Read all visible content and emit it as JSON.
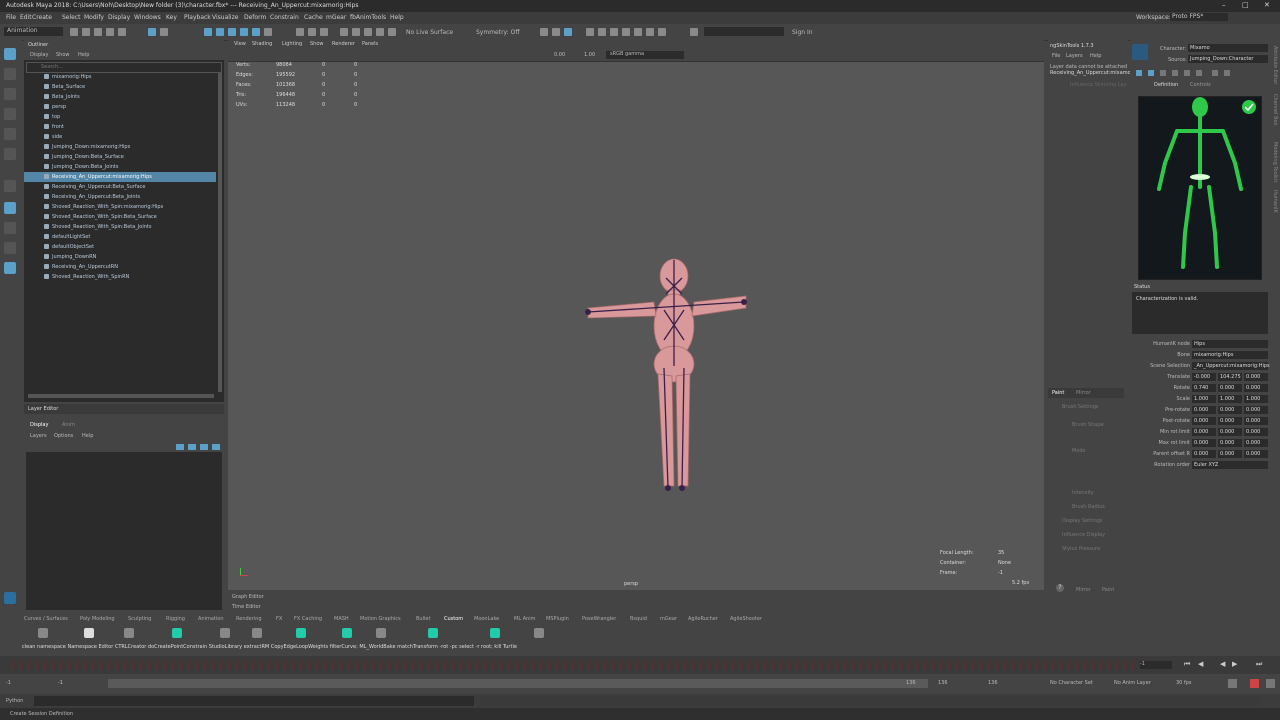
{
  "window": {
    "title": "Autodesk Maya 2018: C:\\Users\\Noh\\Desktop\\New folder (3)\\character.fbx* --- Receiving_An_Uppercut:mixamorig:Hips"
  },
  "menubar": {
    "items": [
      "File",
      "Edit",
      "Create",
      "Select",
      "Modify",
      "Display",
      "Windows",
      "Key",
      "Playback",
      "Visualize",
      "Deform",
      "Constrain",
      "Cache",
      "mGear",
      "fbAnimTools",
      "Help"
    ],
    "workspace_label": "Workspace:",
    "workspace_value": "Proto FPS*"
  },
  "statusline": {
    "mode": "Animation",
    "live_surface": "No Live Surface",
    "symmetry": "Symmetry: Off",
    "sign_in": "Sign In"
  },
  "outliner": {
    "title": "Outliner",
    "menu": [
      "Display",
      "Show",
      "Help"
    ],
    "search_placeholder": "Search...",
    "rows": [
      {
        "label": "mixamorig:Hips",
        "indent": 1,
        "selected": false
      },
      {
        "label": "Beta_Surface",
        "indent": 1,
        "selected": false
      },
      {
        "label": "Beta_Joints",
        "indent": 1,
        "selected": false
      },
      {
        "label": "persp",
        "indent": 1,
        "selected": false
      },
      {
        "label": "top",
        "indent": 1,
        "selected": false
      },
      {
        "label": "front",
        "indent": 1,
        "selected": false
      },
      {
        "label": "side",
        "indent": 1,
        "selected": false
      },
      {
        "label": "Jumping_Down:mixamorig:Hips",
        "indent": 0,
        "selected": false
      },
      {
        "label": "Jumping_Down:Beta_Surface",
        "indent": 0,
        "selected": false
      },
      {
        "label": "Jumping_Down:Beta_Joints",
        "indent": 0,
        "selected": false
      },
      {
        "label": "Receiving_An_Uppercut:mixamorig:Hips",
        "indent": 0,
        "selected": true
      },
      {
        "label": "Receiving_An_Uppercut:Beta_Surface",
        "indent": 0,
        "selected": false
      },
      {
        "label": "Receiving_An_Uppercut:Beta_Joints",
        "indent": 0,
        "selected": false
      },
      {
        "label": "Shoved_Reaction_With_Spin:mixamorig:Hips",
        "indent": 0,
        "selected": false
      },
      {
        "label": "Shoved_Reaction_With_Spin:Beta_Surface",
        "indent": 0,
        "selected": false
      },
      {
        "label": "Shoved_Reaction_With_Spin:Beta_Joints",
        "indent": 0,
        "selected": false
      },
      {
        "label": "defaultLightSet",
        "indent": 0,
        "selected": false
      },
      {
        "label": "defaultObjectSet",
        "indent": 0,
        "selected": false
      },
      {
        "label": "Jumping_DownRN",
        "indent": 0,
        "selected": false
      },
      {
        "label": "Receiving_An_UppercutRN",
        "indent": 0,
        "selected": false
      },
      {
        "label": "Shoved_Reaction_With_SpinRN",
        "indent": 0,
        "selected": false
      }
    ]
  },
  "layer_editor": {
    "title": "Layer Editor",
    "tabs": [
      "Display",
      "Anim"
    ],
    "menu": [
      "Layers",
      "Options",
      "Help"
    ]
  },
  "viewport": {
    "menu": [
      "View",
      "Shading",
      "Lighting",
      "Show",
      "Renderer",
      "Panels"
    ],
    "gamma": "sRGB gamma",
    "val1": "0.00",
    "val2": "1.00",
    "stats": [
      {
        "label": "Verts:",
        "a": "98084",
        "b": "0",
        "c": "0"
      },
      {
        "label": "Edges:",
        "a": "195592",
        "b": "0",
        "c": "0"
      },
      {
        "label": "Faces:",
        "a": "101368",
        "b": "0",
        "c": "0"
      },
      {
        "label": "Tris:",
        "a": "196448",
        "b": "0",
        "c": "0"
      },
      {
        "label": "UVs:",
        "a": "113248",
        "b": "0",
        "c": "0"
      }
    ],
    "camera": "persp",
    "focal_label": "Focal Length:",
    "focal": "35",
    "container_label": "Container:",
    "container": "None",
    "frame_label": "Frame:",
    "frame": "-1",
    "fps": "5.2 fps"
  },
  "skin": {
    "title": "ngSkinTools 1.7.3",
    "menu": [
      "File",
      "Layers",
      "Help"
    ],
    "msg1": "Layer data cannot be attached",
    "msg2": "Receiving_An_Uppercut:mixamo",
    "msg3": "Influence Skinning Lay",
    "tabs": [
      "Paint",
      "Mirror"
    ],
    "labels": [
      "Brush Settings",
      "Brush Shape",
      "Mode",
      "Intensity",
      "Brush Radius",
      "Display Settings",
      "Influence Display",
      "Stylus Pressure"
    ],
    "buttons": [
      "Mirror",
      "Paint"
    ]
  },
  "hik": {
    "character_label": "Character:",
    "character": "Mixamo",
    "source_label": "Source:",
    "source": "Jumping_Down:Character",
    "tabs": [
      "Definition",
      "Controls"
    ],
    "status_title": "Status",
    "status_text": "Characterization is valid.",
    "props": [
      {
        "label": "HumanIK node",
        "v": [
          "Hips"
        ]
      },
      {
        "label": "Bone",
        "v": [
          "mixamorig:Hips"
        ]
      },
      {
        "label": "Scene Selection",
        "v": [
          "_An_Uppercut:mixamorig:Hips"
        ]
      },
      {
        "label": "Translate",
        "v": [
          "-0.000",
          "104.275",
          "0.000"
        ]
      },
      {
        "label": "Rotate",
        "v": [
          "0.740",
          "0.000",
          "0.000"
        ]
      },
      {
        "label": "Scale",
        "v": [
          "1.000",
          "1.000",
          "1.000"
        ]
      },
      {
        "label": "Pre-rotate",
        "v": [
          "0.000",
          "0.000",
          "0.000"
        ]
      },
      {
        "label": "Post-rotate",
        "v": [
          "0.000",
          "0.000",
          "0.000"
        ]
      },
      {
        "label": "Min rot limit",
        "v": [
          "0.000",
          "0.000",
          "0.000"
        ]
      },
      {
        "label": "Max rot limit",
        "v": [
          "0.000",
          "0.000",
          "0.000"
        ]
      },
      {
        "label": "Parent offset R",
        "v": [
          "0.000",
          "0.000",
          "0.000"
        ]
      },
      {
        "label": "Rotation order",
        "v": [
          "Euler XYZ"
        ]
      }
    ],
    "side_tabs": [
      "Attribute Editor",
      "Channel Box",
      "Modeling Toolkit",
      "HumanIK"
    ]
  },
  "graph_editor": "Graph Editor",
  "time_editor": "Time Editor",
  "shelf": {
    "tabs": [
      "Curves / Surfaces",
      "Poly Modeling",
      "Sculpting",
      "Rigging",
      "Animation",
      "Rendering",
      "FX",
      "FX Caching",
      "MASH",
      "Motion Graphics",
      "Bullet",
      "Custom",
      "MoonLake",
      "ML Anim",
      "MSPlugin",
      "PoseWrangler",
      "Bsquid",
      "mGear",
      "AgileRucher",
      "AgileShooter"
    ],
    "active": "Custom",
    "scripts": "clean namespace Namespace Editor CTRLCreator doCreatePointConstrain StudioLibrary extractRM CopyEdgeLoopWeights filterCurve; ML_WorldBake matchTransform -rot -pc  select -r root;  kill Turtle"
  },
  "timeline": {
    "start": "-1",
    "end": "136",
    "current": "-1",
    "range_a": "-1",
    "range_b": "-1",
    "range_c": "136",
    "range_d": "136",
    "range_e": "136",
    "char_set": "No Character Set",
    "anim_layer": "No Anim Layer",
    "fps": "30 fps"
  },
  "cmd": {
    "label": "Python"
  },
  "help": {
    "text": "Create Session Definition"
  }
}
